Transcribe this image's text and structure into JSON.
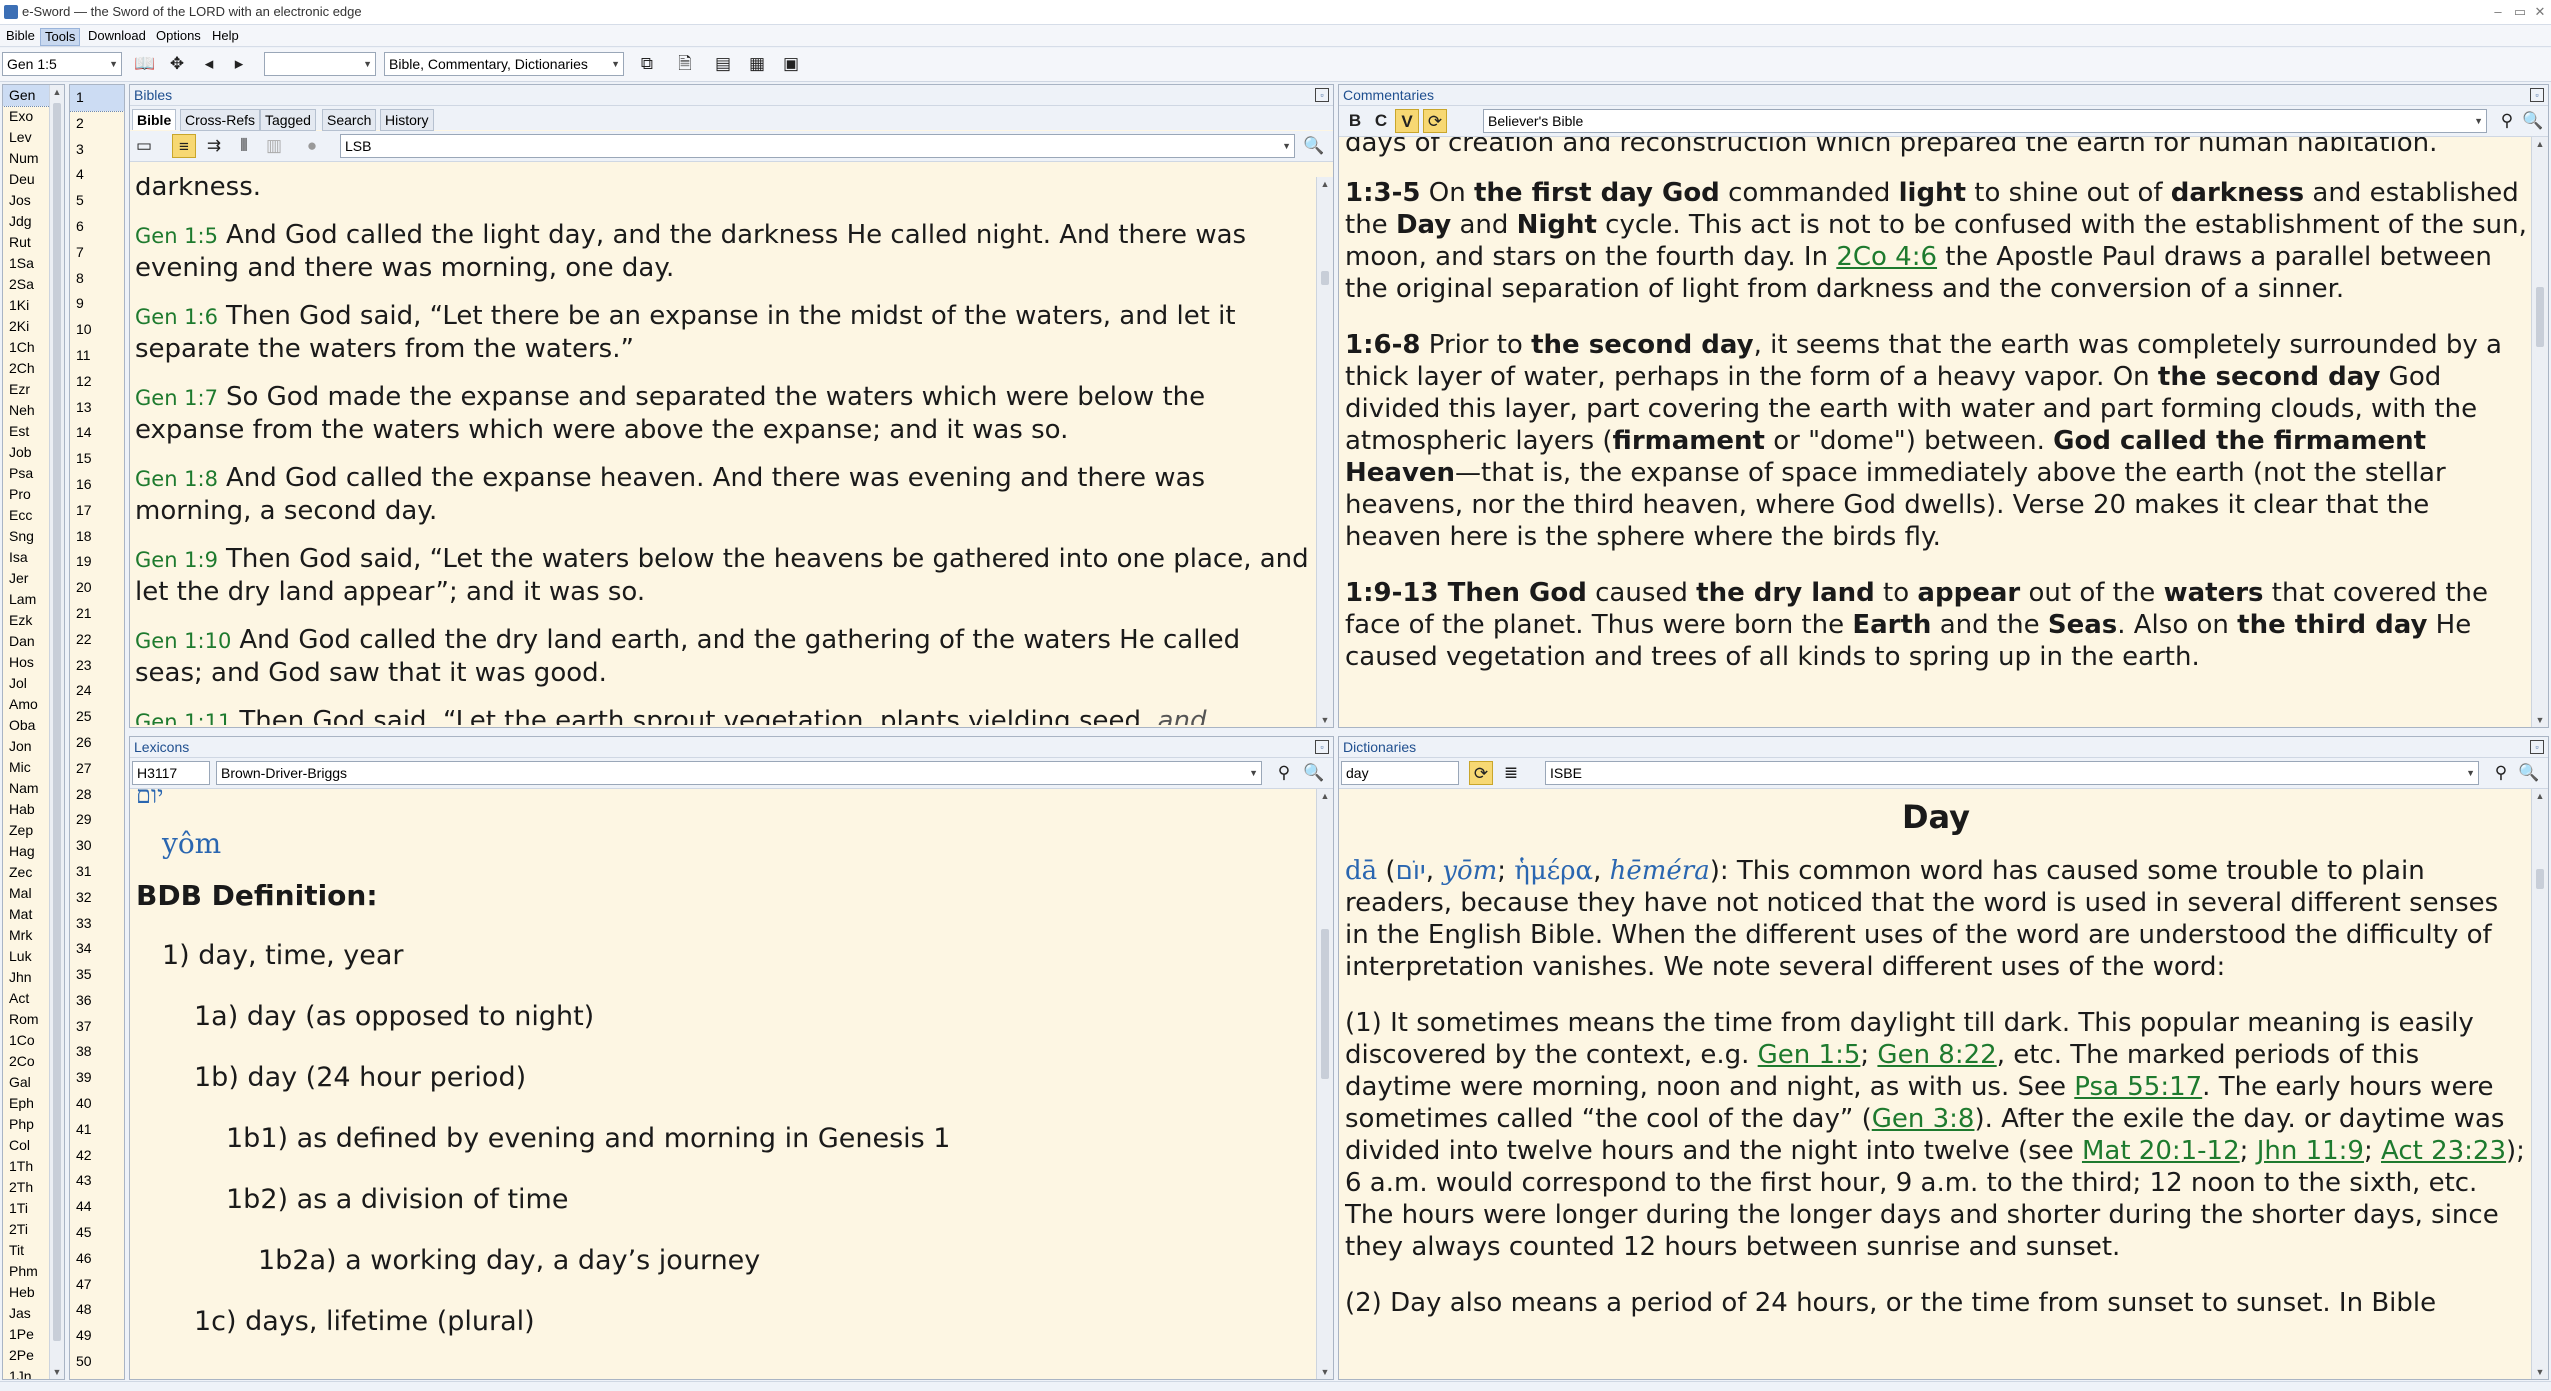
{
  "window": {
    "title": "e-Sword — the Sword of the LORD with an electronic edge"
  },
  "menu": [
    "Bible",
    "Tools",
    "Download",
    "Options",
    "Help"
  ],
  "toolbar": {
    "reference": "Gen 1:5",
    "search_scope": "",
    "module_set": "Bible, Commentary, Dictionaries"
  },
  "books": [
    "Gen",
    "Exo",
    "Lev",
    "Num",
    "Deu",
    "Jos",
    "Jdg",
    "Rut",
    "1Sa",
    "2Sa",
    "1Ki",
    "2Ki",
    "1Ch",
    "2Ch",
    "Ezr",
    "Neh",
    "Est",
    "Job",
    "Psa",
    "Pro",
    "Ecc",
    "Sng",
    "Isa",
    "Jer",
    "Lam",
    "Ezk",
    "Dan",
    "Hos",
    "Jol",
    "Amo",
    "Oba",
    "Jon",
    "Mic",
    "Nam",
    "Hab",
    "Zep",
    "Hag",
    "Zec",
    "Mal",
    "Mat",
    "Mrk",
    "Luk",
    "Jhn",
    "Act",
    "Rom",
    "1Co",
    "2Co",
    "Gal",
    "Eph",
    "Php",
    "Col",
    "1Th",
    "2Th",
    "1Ti",
    "2Ti",
    "Tit",
    "Phm",
    "Heb",
    "Jas",
    "1Pe",
    "2Pe",
    "1Jn"
  ],
  "chapters": [
    "1",
    "2",
    "3",
    "4",
    "5",
    "6",
    "7",
    "8",
    "9",
    "10",
    "11",
    "12",
    "13",
    "14",
    "15",
    "16",
    "17",
    "18",
    "19",
    "20",
    "21",
    "22",
    "23",
    "24",
    "25",
    "26",
    "27",
    "28",
    "29",
    "30",
    "31",
    "32",
    "33",
    "34",
    "35",
    "36",
    "37",
    "38",
    "39",
    "40",
    "41",
    "42",
    "43",
    "44",
    "45",
    "46",
    "47",
    "48",
    "49",
    "50"
  ],
  "bibles": {
    "title": "Bibles",
    "tabs": [
      "Bible",
      "Cross-Refs",
      "Tagged",
      "Search",
      "History"
    ],
    "version": "LSB",
    "top_fragment": "darkness.",
    "verses": [
      {
        "ref": "Gen 1:5",
        "text": "And God called the light day, and the darkness He called night. And there was evening and there was morning, one day."
      },
      {
        "ref": "Gen 1:6",
        "text": "Then God said, “Let there be an expanse in the midst of the waters, and let it separate the waters from the waters.”"
      },
      {
        "ref": "Gen 1:7",
        "text": "So God made the expanse and separated the waters which were below the expanse from the waters which were above the expanse; and it was so."
      },
      {
        "ref": "Gen 1:8",
        "text": "And God called the expanse heaven. And there was evening and there was morning, a second day."
      },
      {
        "ref": "Gen 1:9",
        "text": "Then God said, “Let the waters below the heavens be gathered into one place, and let the dry land appear”; and it was so."
      },
      {
        "ref": "Gen 1:10",
        "text": "And God called the dry land earth, and the gathering of the waters He called seas; and God saw that it was good."
      },
      {
        "ref": "Gen 1:11",
        "text": "Then God said, “Let the earth sprout vegetation, plants yielding seed,",
        "italic": "and"
      }
    ]
  },
  "commentaries": {
    "title": "Commentaries",
    "buttons": [
      "B",
      "C",
      "V"
    ],
    "module": "Believer's Bible",
    "top_fragment": "days of creation and reconstruction which prepared the earth for human habitation.",
    "p1": {
      "a": "1:3-5",
      "b": " On ",
      "c": "the first day God",
      "d": " commanded ",
      "e": "light",
      "f": " to shine out of ",
      "g": "darkness",
      "h": " and established the ",
      "i": "Day",
      "j": " and ",
      "k": "Night",
      "l": " cycle. This act is not to be confused with the establishment of the sun, moon, and stars on the fourth day. In ",
      "link": "2Co 4:6",
      "m": " the Apostle Paul draws a parallel between the original separation of light from darkness and the conversion of a sinner."
    },
    "p2": {
      "a": "1:6-8",
      "b": " Prior to ",
      "c": "the second day",
      "d": ", it seems that the earth was completely surrounded by a thick layer of water, perhaps in the form of a heavy vapor. On ",
      "e": "the second day",
      "f": " God divided this layer, part covering the earth with water and part forming clouds, with the atmospheric layers (",
      "g": "firmament",
      "h": " or \"dome\") between. ",
      "i": "God called the firmament Heaven",
      "j": "—that is, the expanse of space immediately above the earth (not the stellar heavens, nor the third heaven, where God dwells). Verse 20 makes it clear that the heaven here is the sphere where the birds fly."
    },
    "p3": {
      "a": "1:9-13 Then God",
      "b": " caused ",
      "c": "the dry land",
      "d": " to ",
      "e": "appear",
      "f": " out of the ",
      "g": "waters",
      "h": " that covered the face of the planet. Thus were born the ",
      "i": "Earth",
      "j": " and the ",
      "k": "Seas",
      "l": ". Also on ",
      "m": "the third day",
      "n": " He caused vegetation and trees of all kinds to spring up in the earth."
    }
  },
  "lexicons": {
    "title": "Lexicons",
    "strongs": "H3117",
    "module": "Brown-Driver-Briggs",
    "hebrew": "יוֹם",
    "translit": "yôm",
    "heading": "BDB Definition:",
    "lines": [
      {
        "t": "1) day, time, year",
        "lvl": 1
      },
      {
        "t": "1a) day (as opposed to night)",
        "lvl": 2
      },
      {
        "t": "1b) day (24 hour period)",
        "lvl": 2
      },
      {
        "t": "1b1) as defined by evening and morning in Genesis 1",
        "lvl": 3
      },
      {
        "t": "1b2) as a division of time",
        "lvl": 3
      },
      {
        "t": "1b2a) a working day, a day’s journey",
        "lvl": 4
      },
      {
        "t": "1c) days, lifetime (plural)",
        "lvl": 2
      }
    ]
  },
  "dictionaries": {
    "title": "Dictionaries",
    "search_value": "day",
    "module": "ISBE",
    "heading": "Day",
    "intro": {
      "translit": "dā",
      "hebrew": "יוֹם",
      "yom": "yōm",
      "greek": "ἡμέρα",
      "hemera": "hēméra",
      "text": "): This common word has caused some trouble to plain readers, because they have not noticed that the word is used in several different senses in the English Bible. When the different uses of the word are understood the difficulty of interpretation vanishes. We note several different uses of the word:"
    },
    "p1": {
      "a": "(1) It sometimes means the time from daylight till dark. This popular meaning is easily discovered by the context, e.g. ",
      "l1": "Gen 1:5",
      "b": "; ",
      "l2": "Gen 8:22",
      "c": ", etc. The marked periods of this daytime were morning, noon and night, as with us. See ",
      "l3": "Psa 55:17",
      "d": ". The early hours were sometimes called “the cool of the day” (",
      "l4": "Gen 3:8",
      "e": "). After the exile the day. or daytime was divided into twelve hours and the night into twelve (see ",
      "l5": "Mat 20:1-12",
      "f": "; ",
      "l6": "Jhn 11:9",
      "g": "; ",
      "l7": "Act 23:23",
      "h": "); 6 a.m. would correspond to the first hour, 9 a.m. to the third; 12 noon to the sixth, etc. The hours were longer during the longer days and shorter during the shorter days, since they always counted 12 hours between sunrise and sunset."
    },
    "p2": "(2) Day also means a period of 24 hours, or the time from sunset to sunset. In Bible"
  },
  "colors": {
    "panel_bg": "#fdf6e3",
    "link": "#1e7a2e",
    "title_blue": "#1f4f8f",
    "highlight": "#f7d873"
  }
}
